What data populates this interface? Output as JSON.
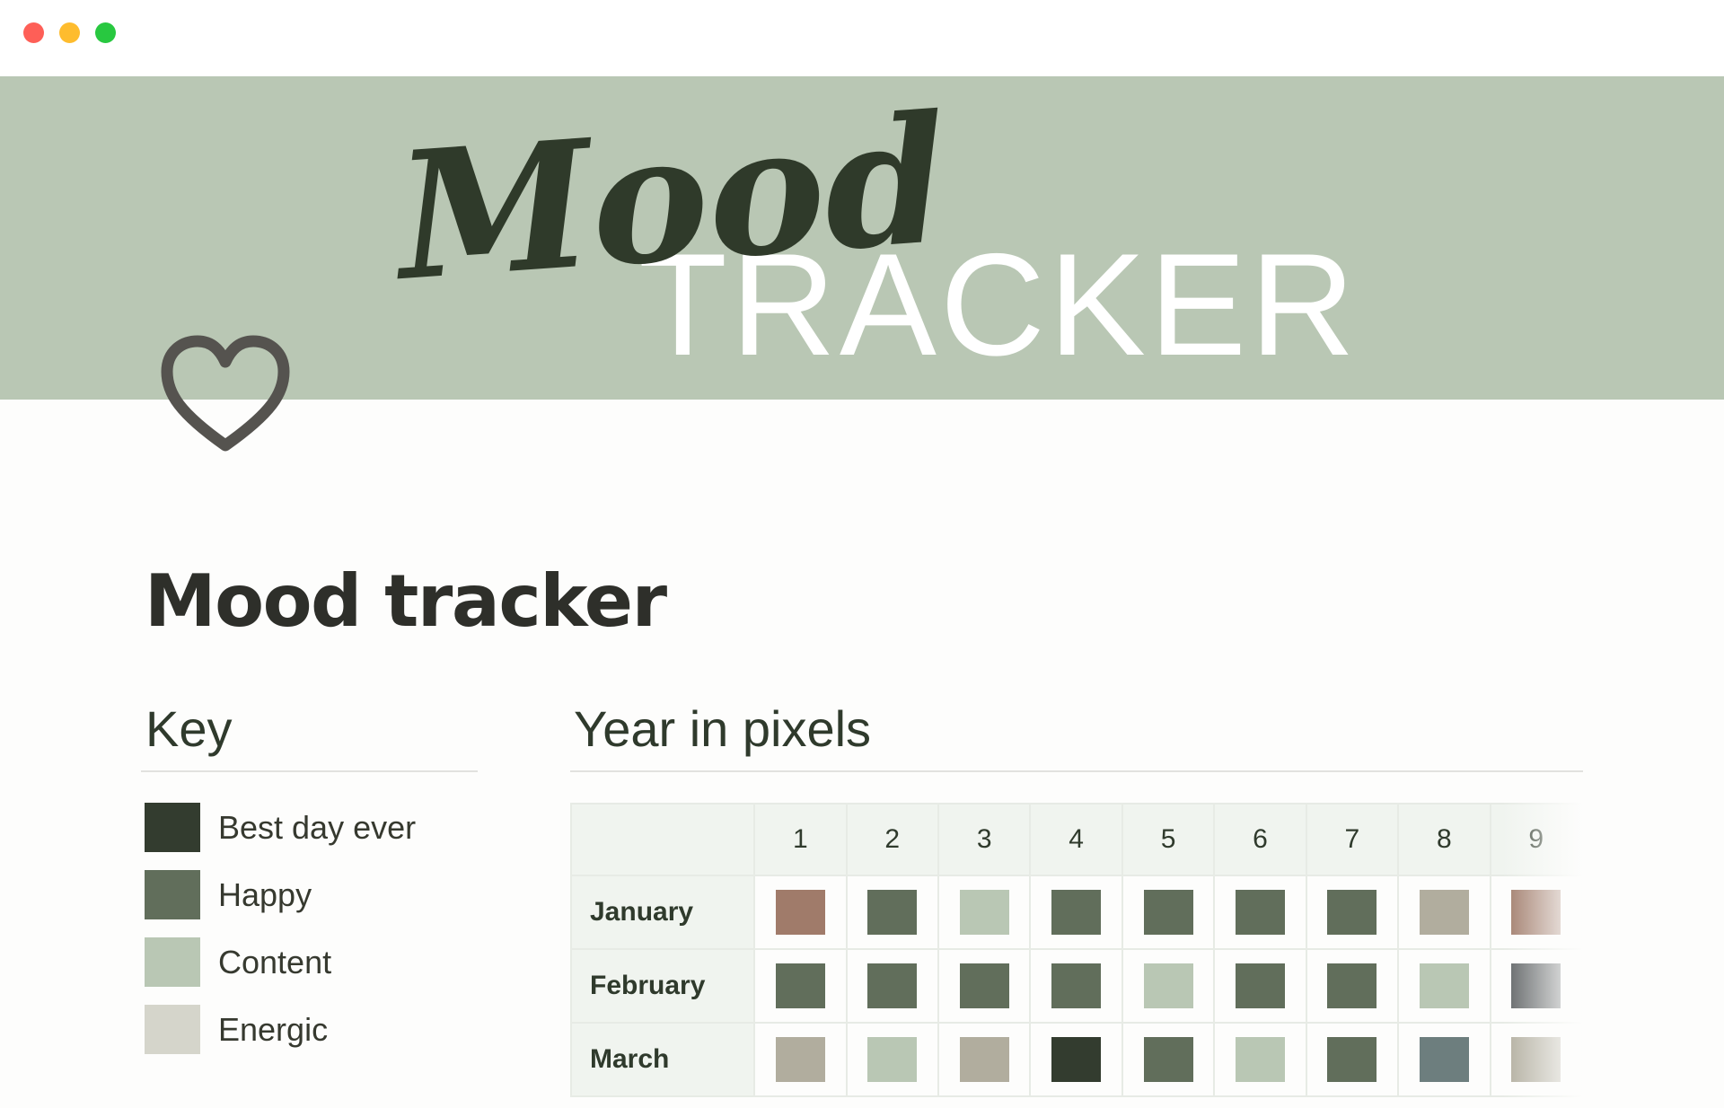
{
  "window": {
    "controls": [
      "close",
      "minimize",
      "zoom"
    ]
  },
  "banner": {
    "script_word": "Mood",
    "caps_word": "TRACKER",
    "background": "#b9c7b4",
    "script_color": "#2f3a2a",
    "caps_color": "#ffffff"
  },
  "page_icon": "heart-outline-icon",
  "page": {
    "title": "Mood tracker"
  },
  "key": {
    "heading": "Key",
    "items": [
      {
        "label": "Best day ever",
        "color": "#333c2f"
      },
      {
        "label": "Happy",
        "color": "#616e5b"
      },
      {
        "label": "Content",
        "color": "#b9c7b4"
      },
      {
        "label": "Energic",
        "color": "#d5d5cb"
      }
    ]
  },
  "year_in_pixels": {
    "heading": "Year in pixels",
    "days": [
      "1",
      "2",
      "3",
      "4",
      "5",
      "6",
      "7",
      "8",
      "9"
    ],
    "months": [
      {
        "name": "January",
        "colors": [
          "#a07b6a",
          "#616e5b",
          "#b9c7b4",
          "#616e5b",
          "#616e5b",
          "#616e5b",
          "#616e5b",
          "#b1ad9e",
          "#a07b6a"
        ]
      },
      {
        "name": "February",
        "colors": [
          "#616e5b",
          "#616e5b",
          "#616e5b",
          "#616e5b",
          "#b9c7b4",
          "#616e5b",
          "#616e5b",
          "#b9c7b4",
          "#5e6264"
        ]
      },
      {
        "name": "March",
        "colors": [
          "#b1ad9e",
          "#b9c7b4",
          "#b1ad9e",
          "#333c2f",
          "#616e5b",
          "#b9c7b4",
          "#616e5b",
          "#6d7e7e",
          "#b1ad9e"
        ]
      }
    ]
  }
}
